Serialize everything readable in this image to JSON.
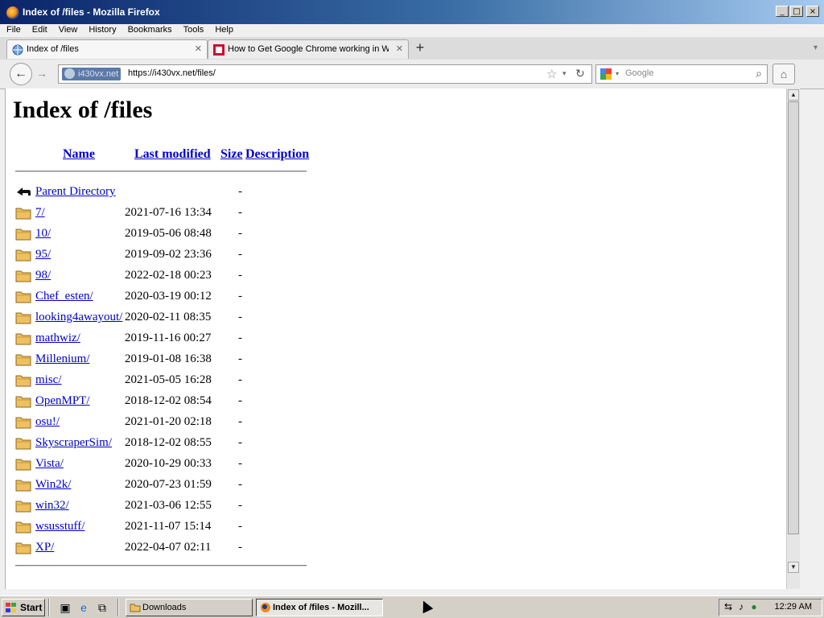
{
  "window": {
    "title": "Index of /files - Mozilla Firefox"
  },
  "menu": [
    "File",
    "Edit",
    "View",
    "History",
    "Bookmarks",
    "Tools",
    "Help"
  ],
  "tabs": [
    {
      "label": "Index of /files",
      "active": true
    },
    {
      "label": "How to Get Google Chrome working in Wi...",
      "active": false
    }
  ],
  "nav": {
    "identity": "i430vx.net",
    "url": "https://i430vx.net/files/",
    "search_placeholder": "Google"
  },
  "page": {
    "heading": "Index of /files",
    "columns": {
      "name": "Name",
      "modified": "Last modified",
      "size": "Size",
      "description": "Description"
    },
    "parent": {
      "name": "Parent Directory",
      "size": "-"
    },
    "entries": [
      {
        "name": "7/",
        "modified": "2021-07-16 13:34",
        "size": "-"
      },
      {
        "name": "10/",
        "modified": "2019-05-06 08:48",
        "size": "-"
      },
      {
        "name": "95/",
        "modified": "2019-09-02 23:36",
        "size": "-"
      },
      {
        "name": "98/",
        "modified": "2022-02-18 00:23",
        "size": "-"
      },
      {
        "name": "Chef_esten/",
        "modified": "2020-03-19 00:12",
        "size": "-"
      },
      {
        "name": "looking4awayout/",
        "modified": "2020-02-11 08:35",
        "size": "-"
      },
      {
        "name": "mathwiz/",
        "modified": "2019-11-16 00:27",
        "size": "-"
      },
      {
        "name": "Millenium/",
        "modified": "2019-01-08 16:38",
        "size": "-"
      },
      {
        "name": "misc/",
        "modified": "2021-05-05 16:28",
        "size": "-"
      },
      {
        "name": "OpenMPT/",
        "modified": "2018-12-02 08:54",
        "size": "-"
      },
      {
        "name": "osu!/",
        "modified": "2021-01-20 02:18",
        "size": "-"
      },
      {
        "name": "SkyscraperSim/",
        "modified": "2018-12-02 08:55",
        "size": "-"
      },
      {
        "name": "Vista/",
        "modified": "2020-10-29 00:33",
        "size": "-"
      },
      {
        "name": "Win2k/",
        "modified": "2020-07-23 01:59",
        "size": "-"
      },
      {
        "name": "win32/",
        "modified": "2021-03-06 12:55",
        "size": "-"
      },
      {
        "name": "wsusstuff/",
        "modified": "2021-11-07 15:14",
        "size": "-"
      },
      {
        "name": "XP/",
        "modified": "2022-04-07 02:11",
        "size": "-"
      }
    ]
  },
  "taskbar": {
    "start_label": "Start",
    "tasks": [
      {
        "label": "Downloads",
        "active": false
      },
      {
        "label": "Index of /files - Mozill...",
        "active": true
      }
    ],
    "clock": "12:29 AM"
  },
  "colors": {
    "link": "#0000cc",
    "titlebar_start": "#0a246a",
    "desktop": "#3a6ea5",
    "folder": "#f0c060"
  }
}
